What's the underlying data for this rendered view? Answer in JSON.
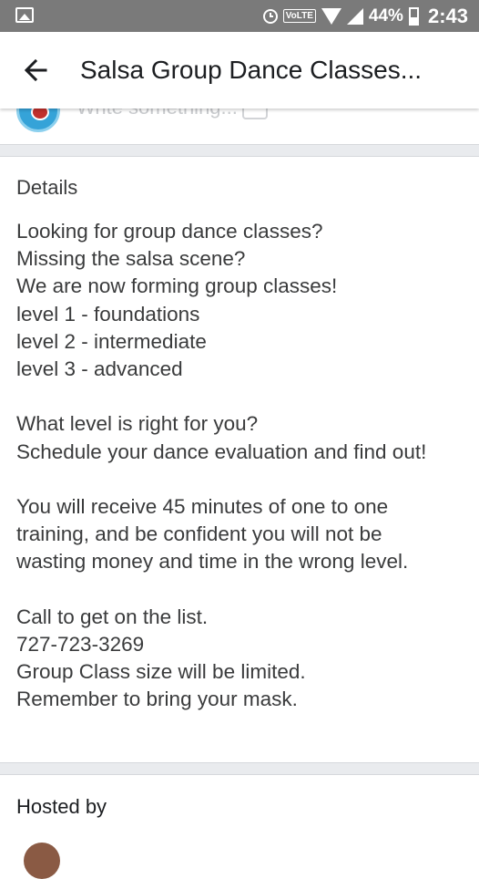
{
  "status_bar": {
    "volte": "VoLTE",
    "battery_percent": "44%",
    "time": "2:43",
    "battery_level": 0.44,
    "icons": [
      "gallery-icon",
      "alarm-icon",
      "wifi-icon",
      "signal-icon",
      "battery-icon"
    ]
  },
  "app_bar": {
    "title": "Salsa Group Dance Classes...",
    "back_icon": "arrow-left-icon"
  },
  "composer": {
    "placeholder": "Write something..."
  },
  "details": {
    "heading": "Details",
    "lines": [
      "Looking for group dance classes?",
      "Missing the salsa scene?",
      "We are now forming group classes!",
      "level 1 - foundations",
      "level 2 - intermediate",
      "level 3 - advanced",
      "",
      "What level is right for you?",
      "Schedule your dance evaluation and find out!",
      "",
      "You will receive 45 minutes of one to one",
      "training, and be confident you will not be",
      "wasting money and time in the wrong level.",
      "",
      "Call to get on the list.",
      "727-723-3269",
      "Group Class size will be limited.",
      "Remember to bring your mask."
    ]
  },
  "hosted": {
    "heading": "Hosted by"
  },
  "colors": {
    "status_bar_bg": "#7a7a7a",
    "divider_bg": "#e9ebee",
    "text": "#3a3b3c"
  }
}
